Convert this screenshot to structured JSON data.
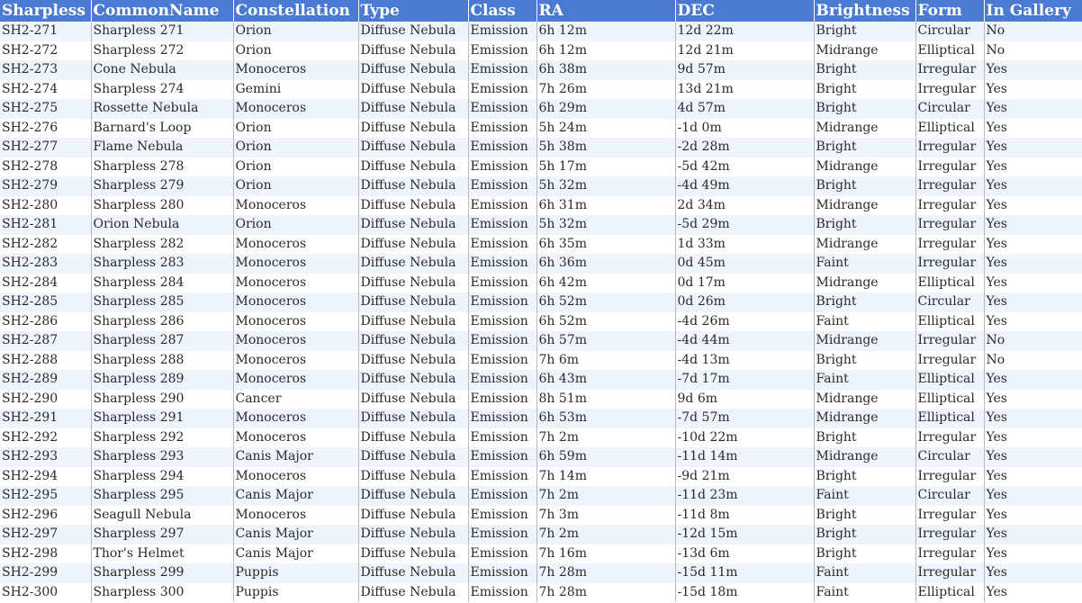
{
  "table": {
    "columns": [
      "Sharpless",
      "CommonName",
      "Constellation",
      "Type",
      "Class",
      "RA",
      "DEC",
      "Brightness",
      "Form",
      "In Gallery"
    ],
    "rows": [
      [
        "SH2-271",
        "Sharpless 271",
        "Orion",
        "Diffuse Nebula",
        "Emission",
        "6h 12m",
        "12d 22m",
        "Bright",
        "Circular",
        "No"
      ],
      [
        "SH2-272",
        "Sharpless 272",
        "Orion",
        "Diffuse Nebula",
        "Emission",
        "6h 12m",
        "12d 21m",
        "Midrange",
        "Elliptical",
        "No"
      ],
      [
        "SH2-273",
        "Cone Nebula",
        "Monoceros",
        "Diffuse Nebula",
        "Emission",
        "6h 38m",
        "9d 57m",
        "Bright",
        "Irregular",
        "Yes"
      ],
      [
        "SH2-274",
        "Sharpless 274",
        "Gemini",
        "Diffuse Nebula",
        "Emission",
        "7h 26m",
        "13d 21m",
        "Bright",
        "Irregular",
        "Yes"
      ],
      [
        "SH2-275",
        "Rossette Nebula",
        "Monoceros",
        "Diffuse Nebula",
        "Emission",
        "6h 29m",
        "4d 57m",
        "Bright",
        "Circular",
        "Yes"
      ],
      [
        "SH2-276",
        "Barnard's Loop",
        "Orion",
        "Diffuse Nebula",
        "Emission",
        "5h 24m",
        "-1d 0m",
        "Midrange",
        "Elliptical",
        "Yes"
      ],
      [
        "SH2-277",
        "Flame Nebula",
        "Orion",
        "Diffuse Nebula",
        "Emission",
        "5h 38m",
        "-2d 28m",
        "Bright",
        "Irregular",
        "Yes"
      ],
      [
        "SH2-278",
        "Sharpless 278",
        "Orion",
        "Diffuse Nebula",
        "Emission",
        "5h 17m",
        "-5d 42m",
        "Midrange",
        "Irregular",
        "Yes"
      ],
      [
        "SH2-279",
        "Sharpless 279",
        "Orion",
        "Diffuse Nebula",
        "Emission",
        "5h 32m",
        "-4d 49m",
        "Bright",
        "Irregular",
        "Yes"
      ],
      [
        "SH2-280",
        "Sharpless 280",
        "Monoceros",
        "Diffuse Nebula",
        "Emission",
        "6h 31m",
        "2d 34m",
        "Midrange",
        "Irregular",
        "Yes"
      ],
      [
        "SH2-281",
        "Orion Nebula",
        "Orion",
        "Diffuse Nebula",
        "Emission",
        "5h 32m",
        "-5d 29m",
        "Bright",
        "Irregular",
        "Yes"
      ],
      [
        "SH2-282",
        "Sharpless 282",
        "Monoceros",
        "Diffuse Nebula",
        "Emission",
        "6h 35m",
        "1d 33m",
        "Midrange",
        "Irregular",
        "Yes"
      ],
      [
        "SH2-283",
        "Sharpless 283",
        "Monoceros",
        "Diffuse Nebula",
        "Emission",
        "6h 36m",
        "0d 45m",
        "Faint",
        "Irregular",
        "Yes"
      ],
      [
        "SH2-284",
        "Sharpless 284",
        "Monoceros",
        "Diffuse Nebula",
        "Emission",
        "6h 42m",
        "0d 17m",
        "Midrange",
        "Elliptical",
        "Yes"
      ],
      [
        "SH2-285",
        "Sharpless 285",
        "Monoceros",
        "Diffuse Nebula",
        "Emission",
        "6h 52m",
        "0d 26m",
        "Bright",
        "Circular",
        "Yes"
      ],
      [
        "SH2-286",
        "Sharpless 286",
        "Monoceros",
        "Diffuse Nebula",
        "Emission",
        "6h 52m",
        "-4d 26m",
        "Faint",
        "Elliptical",
        "Yes"
      ],
      [
        "SH2-287",
        "Sharpless 287",
        "Monoceros",
        "Diffuse Nebula",
        "Emission",
        "6h 57m",
        "-4d 44m",
        "Midrange",
        "Irregular",
        "No"
      ],
      [
        "SH2-288",
        "Sharpless 288",
        "Monoceros",
        "Diffuse Nebula",
        "Emission",
        "7h 6m",
        "-4d 13m",
        "Bright",
        "Irregular",
        "No"
      ],
      [
        "SH2-289",
        "Sharpless 289",
        "Monoceros",
        "Diffuse Nebula",
        "Emission",
        "6h 43m",
        "-7d 17m",
        "Faint",
        "Elliptical",
        "Yes"
      ],
      [
        "SH2-290",
        "Sharpless 290",
        "Cancer",
        "Diffuse Nebula",
        "Emission",
        "8h 51m",
        "9d 6m",
        "Midrange",
        "Elliptical",
        "Yes"
      ],
      [
        "SH2-291",
        "Sharpless 291",
        "Monoceros",
        "Diffuse Nebula",
        "Emission",
        "6h 53m",
        "-7d 57m",
        "Midrange",
        "Elliptical",
        "Yes"
      ],
      [
        "SH2-292",
        "Sharpless 292",
        "Monoceros",
        "Diffuse Nebula",
        "Emission",
        "7h 2m",
        "-10d 22m",
        "Bright",
        "Irregular",
        "Yes"
      ],
      [
        "SH2-293",
        "Sharpless 293",
        "Canis Major",
        "Diffuse Nebula",
        "Emission",
        "6h 59m",
        "-11d 14m",
        "Midrange",
        "Circular",
        "Yes"
      ],
      [
        "SH2-294",
        "Sharpless 294",
        "Monoceros",
        "Diffuse Nebula",
        "Emission",
        "7h 14m",
        "-9d 21m",
        "Bright",
        "Irregular",
        "Yes"
      ],
      [
        "SH2-295",
        "Sharpless 295",
        "Canis Major",
        "Diffuse Nebula",
        "Emission",
        "7h 2m",
        "-11d 23m",
        "Faint",
        "Circular",
        "Yes"
      ],
      [
        "SH2-296",
        "Seagull Nebula",
        "Monoceros",
        "Diffuse Nebula",
        "Emission",
        "7h 3m",
        "-11d 8m",
        "Bright",
        "Irregular",
        "Yes"
      ],
      [
        "SH2-297",
        "Sharpless 297",
        "Canis Major",
        "Diffuse Nebula",
        "Emission",
        "7h 2m",
        "-12d 15m",
        "Bright",
        "Irregular",
        "Yes"
      ],
      [
        "SH2-298",
        "Thor's Helmet",
        "Canis Major",
        "Diffuse Nebula",
        "Emission",
        "7h 16m",
        "-13d 6m",
        "Bright",
        "Irregular",
        "Yes"
      ],
      [
        "SH2-299",
        "Sharpless 299",
        "Puppis",
        "Diffuse Nebula",
        "Emission",
        "7h 28m",
        "-15d 11m",
        "Faint",
        "Irregular",
        "Yes"
      ],
      [
        "SH2-300",
        "Sharpless 300",
        "Puppis",
        "Diffuse Nebula",
        "Emission",
        "7h 28m",
        "-15d 18m",
        "Faint",
        "Elliptical",
        "Yes"
      ]
    ]
  }
}
